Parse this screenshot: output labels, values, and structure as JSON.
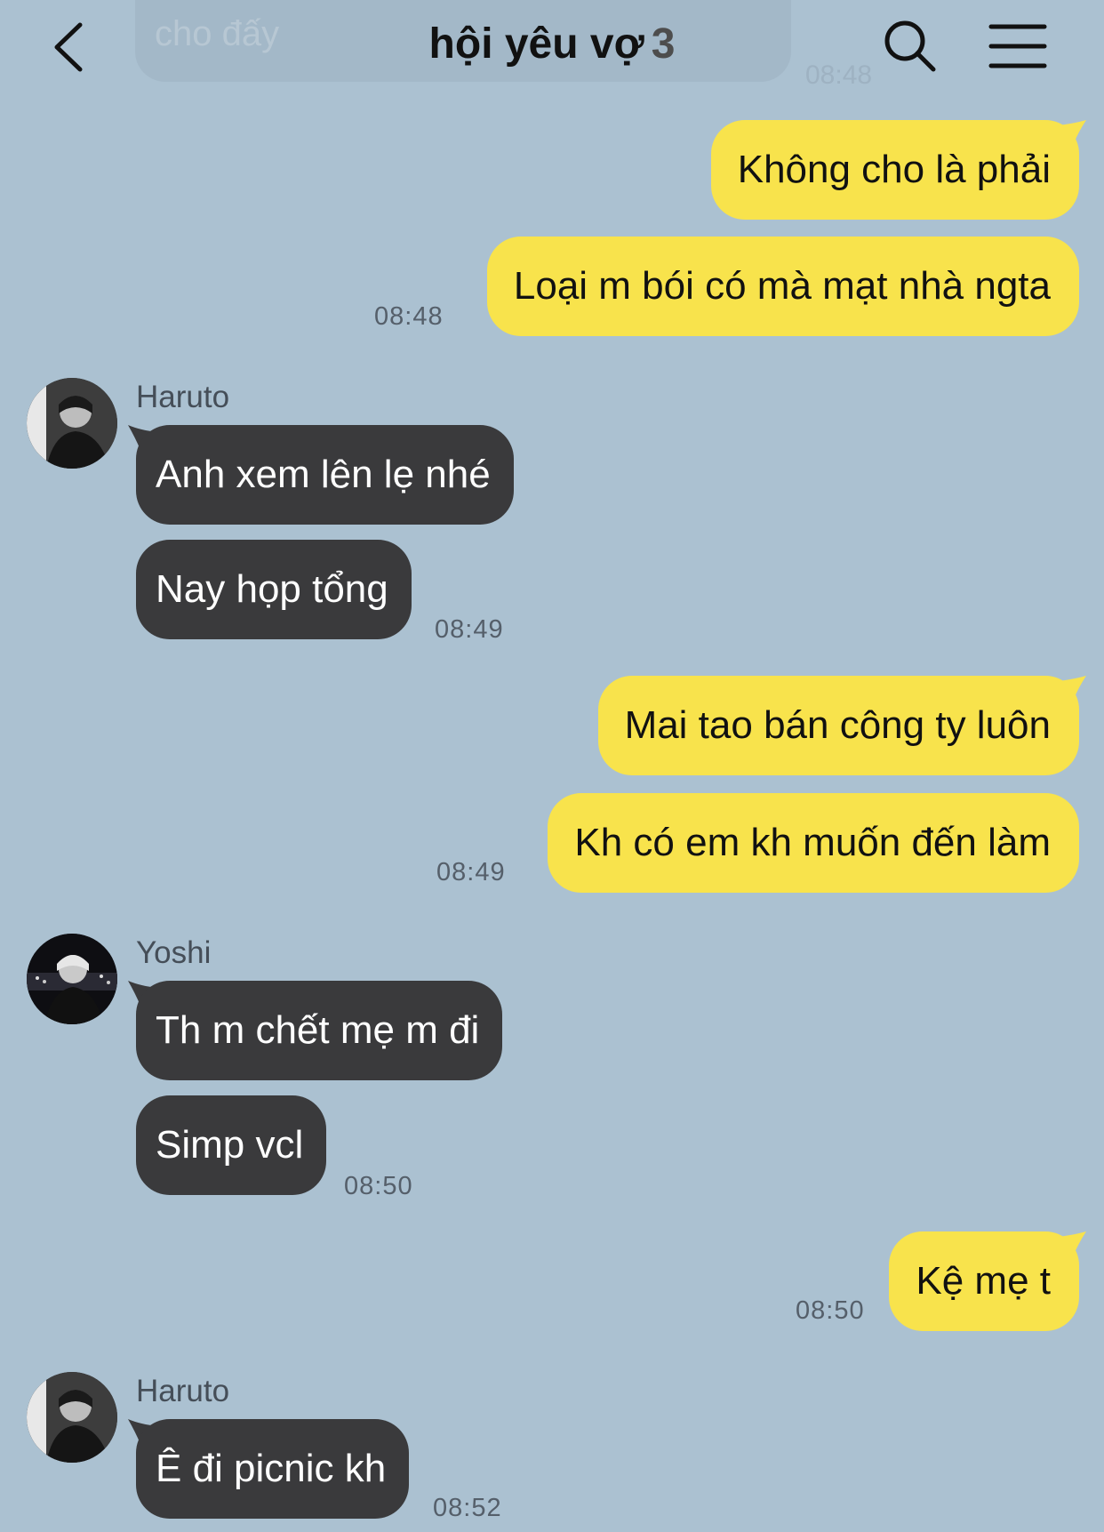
{
  "header": {
    "title": "hội yêu vợ",
    "member_count": "3",
    "faded_message_text": "cho đấy",
    "faded_message_time": "08:48"
  },
  "messages": [
    {
      "id": "m1",
      "from": "me",
      "text": "Không cho là phải",
      "time": ""
    },
    {
      "id": "m2",
      "from": "me",
      "text": "Loại m bói có mà mạt nhà ngta",
      "time": "08:48"
    },
    {
      "id": "m3",
      "from": "Haruto",
      "text": "Anh xem lên lẹ nhé",
      "time": ""
    },
    {
      "id": "m4",
      "from": "Haruto",
      "text": "Nay họp tổng",
      "time": "08:49"
    },
    {
      "id": "m5",
      "from": "me",
      "text": "Mai tao bán công ty luôn",
      "time": ""
    },
    {
      "id": "m6",
      "from": "me",
      "text": "Kh có em kh muốn đến làm",
      "time": "08:49"
    },
    {
      "id": "m7",
      "from": "Yoshi",
      "text": "Th m chết mẹ m đi",
      "time": ""
    },
    {
      "id": "m8",
      "from": "Yoshi",
      "text": "Simp vcl",
      "time": "08:50"
    },
    {
      "id": "m9",
      "from": "me",
      "text": "Kệ mẹ t",
      "time": "08:50"
    },
    {
      "id": "m10",
      "from": "Haruto",
      "text": "Ê đi picnic kh",
      "time": "08:52"
    }
  ],
  "senders": {
    "haruto_1": "Haruto",
    "yoshi": "Yoshi",
    "haruto_2": "Haruto"
  },
  "colors": {
    "background": "#abc1d1",
    "outgoing_bubble": "#f8e34c",
    "incoming_bubble": "#3a3a3c"
  },
  "icons": {
    "back": "chevron-left-icon",
    "search": "search-icon",
    "menu": "hamburger-menu-icon"
  }
}
